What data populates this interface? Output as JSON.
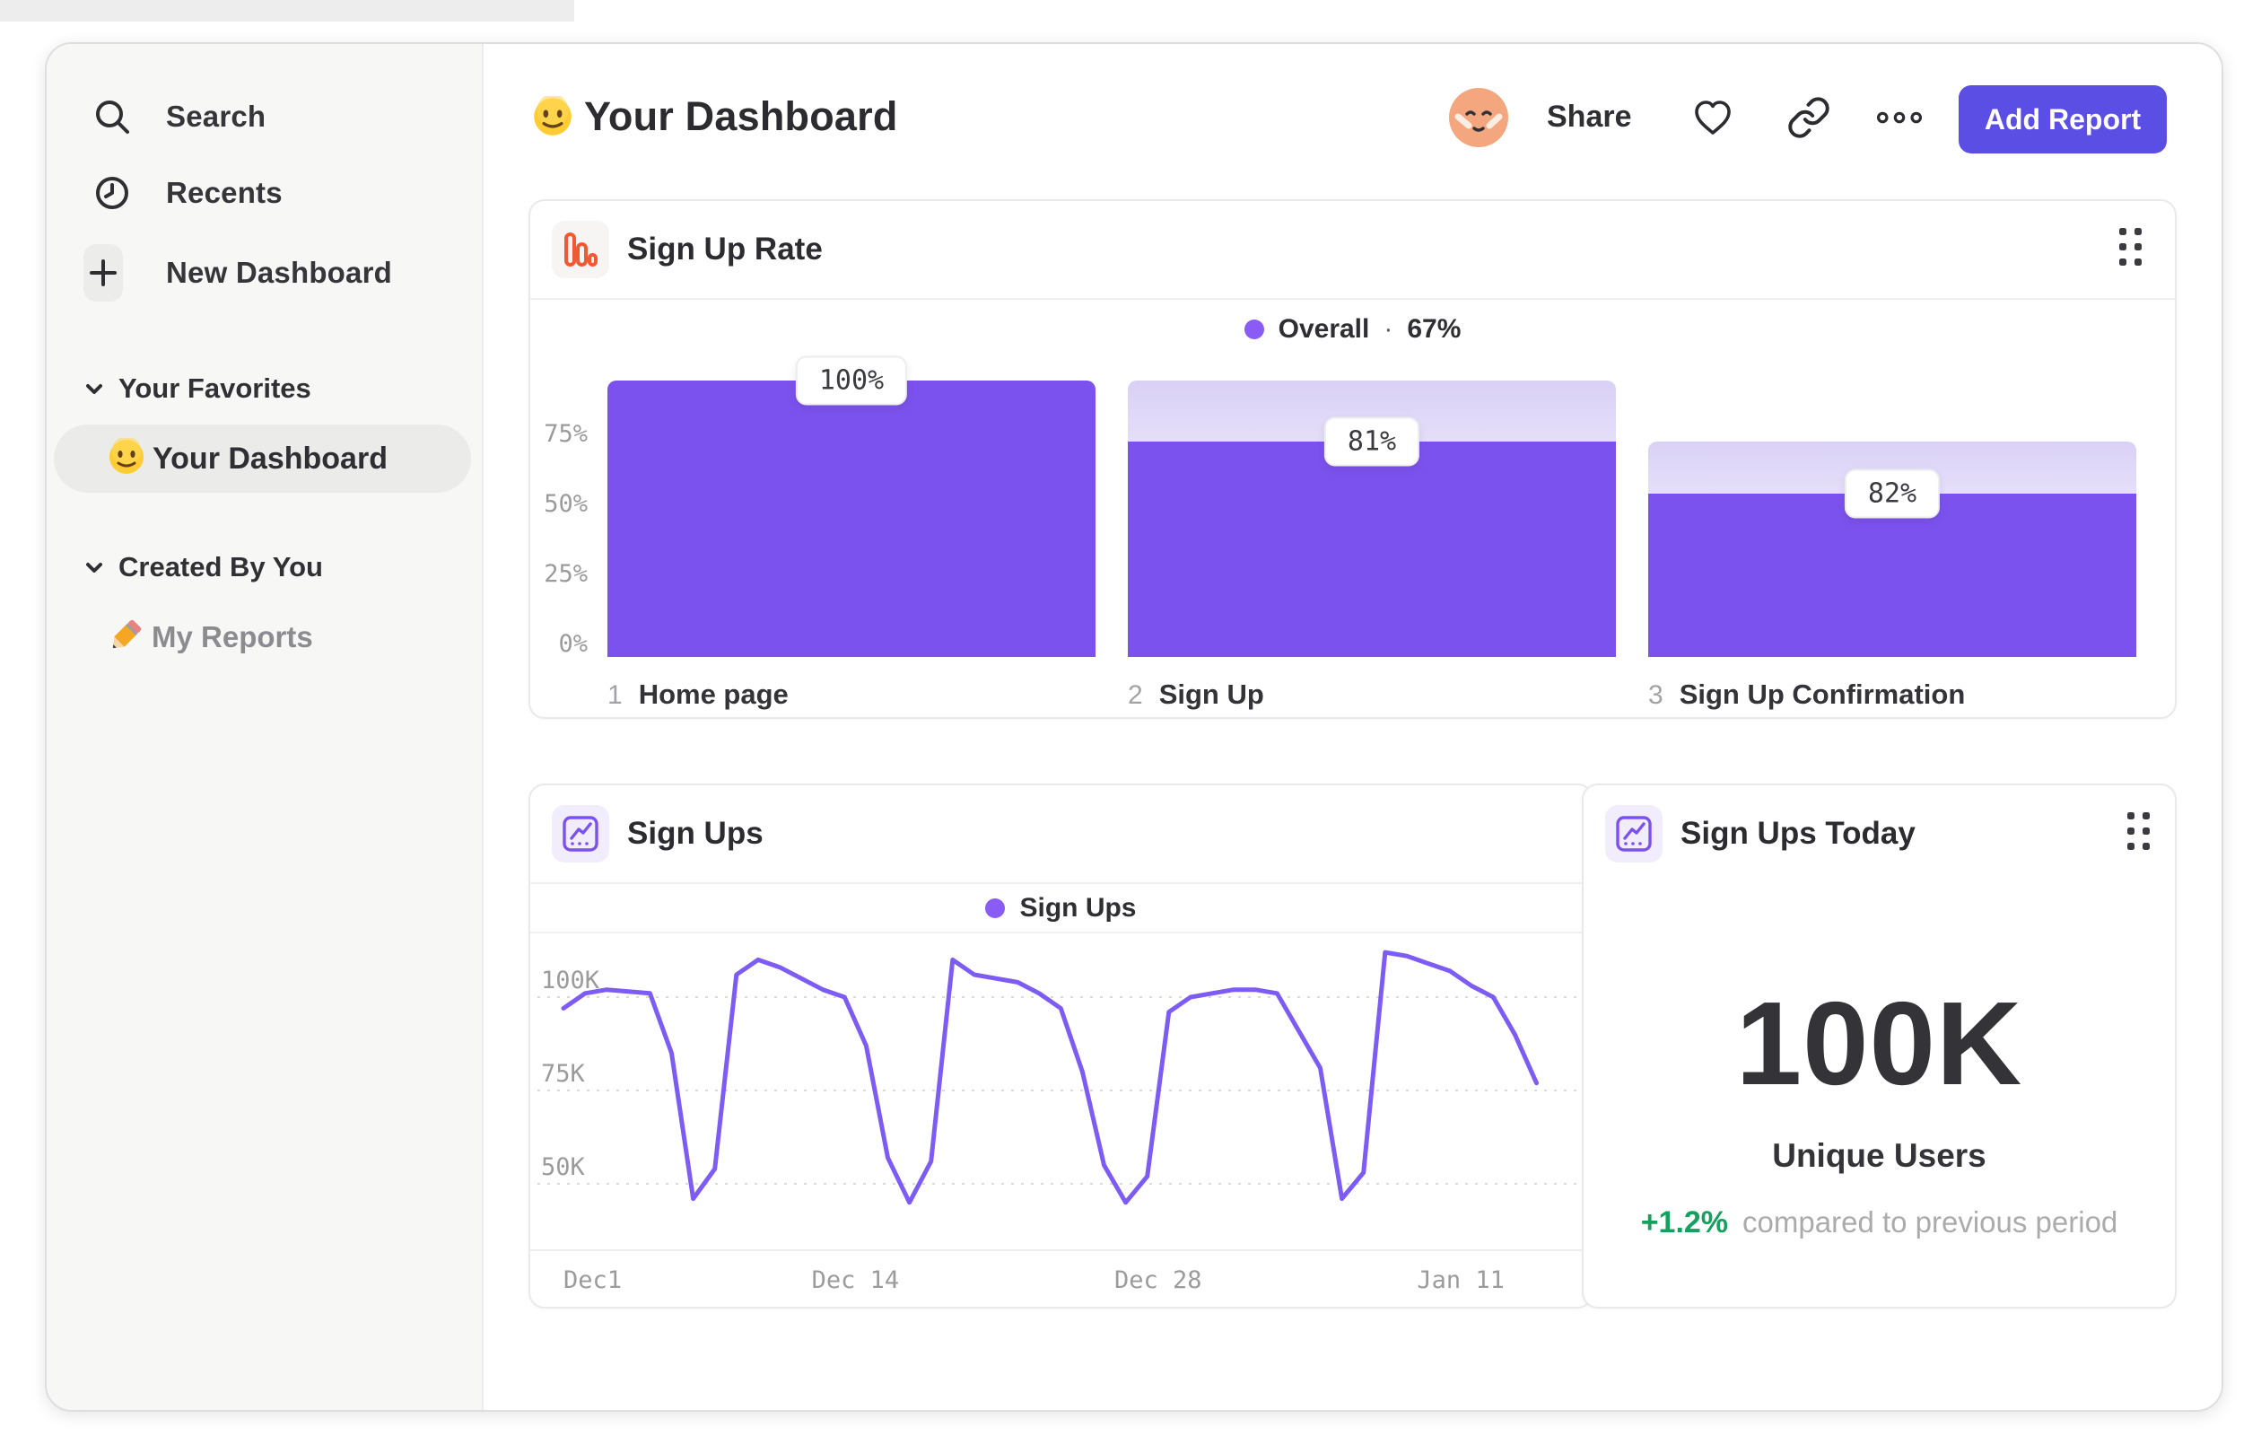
{
  "theme": {
    "accent_purple": "#5B4EE4",
    "bar_purple": "#7C52EE",
    "line_purple": "#7D5BF5",
    "legend_purple": "#8A5CF5",
    "icon_orange": "#EF5A33",
    "delta_green": "#14A05E"
  },
  "sidebar": {
    "nav": [
      {
        "label": "Search",
        "icon": "search-icon"
      },
      {
        "label": "Recents",
        "icon": "clock-icon"
      },
      {
        "label": "New Dashboard",
        "icon": "plus-icon"
      }
    ],
    "sections": [
      {
        "title": "Your Favorites",
        "items": [
          {
            "emoji": "slightly-smiling-face",
            "label": "Your Dashboard",
            "selected": true
          }
        ]
      },
      {
        "title": "Created By You",
        "items": [
          {
            "emoji": "pencil",
            "label": "My Reports",
            "selected": false
          }
        ]
      }
    ]
  },
  "header": {
    "emoji": "slightly-smiling-face",
    "title": "Your Dashboard",
    "share": "Share",
    "add_report": "Add Report"
  },
  "funnel_card": {
    "title": "Sign Up Rate",
    "legend": {
      "label": "Overall",
      "sep": "·",
      "value": "67%"
    }
  },
  "line_card": {
    "title": "Sign Ups",
    "legend": "Sign Ups"
  },
  "metric_card": {
    "title": "Sign Ups Today",
    "value": "100K",
    "label": "Unique Users",
    "delta": "+1.2%",
    "delta_desc": "compared to previous period"
  },
  "chart_data": [
    {
      "type": "bar",
      "subtype": "funnel",
      "title": "Sign Up Rate",
      "legend": "Overall · 67%",
      "legend_position": "top-center",
      "overall_conversion_pct": 67,
      "categories": [
        "Home page",
        "Sign Up",
        "Sign Up Confirmation"
      ],
      "steps": [
        {
          "num": "1",
          "label": "Home page",
          "conversion_label": "100%",
          "conversion_pct": 100,
          "entering_pct": 100,
          "cumulative_pct": 100
        },
        {
          "num": "2",
          "label": "Sign Up",
          "conversion_label": "81%",
          "conversion_pct": 81,
          "entering_pct": 100,
          "cumulative_pct": 81
        },
        {
          "num": "3",
          "label": "Sign Up Confirmation",
          "conversion_label": "82%",
          "conversion_pct": 82,
          "entering_pct": 81,
          "cumulative_pct": 67
        }
      ],
      "y_ticks": [
        {
          "label": "75%",
          "pct": 75
        },
        {
          "label": "50%",
          "pct": 50
        },
        {
          "label": "25%",
          "pct": 25
        },
        {
          "label": "0%",
          "pct": 0
        }
      ],
      "ylim": [
        0,
        100
      ],
      "grid": false,
      "bar_outer_pct": [
        100,
        100,
        78
      ],
      "bar_fill_pct": [
        100,
        78,
        59
      ]
    },
    {
      "type": "line",
      "title": "Sign Ups",
      "legend_position": "top-center",
      "series": [
        {
          "name": "Sign Ups",
          "unit": "K",
          "values": [
            97,
            101,
            102,
            101.5,
            101,
            85,
            46,
            54,
            106,
            110,
            108,
            105,
            102,
            100,
            87,
            57,
            45,
            56,
            110,
            106,
            105,
            104,
            101,
            97,
            80,
            55,
            45,
            52,
            96,
            100,
            101,
            102,
            102,
            101,
            91,
            81,
            46,
            53,
            112,
            111,
            109,
            107,
            103,
            100,
            90,
            77
          ]
        }
      ],
      "x_ticks": [
        {
          "label": "Dec1",
          "day": 0,
          "align": "left"
        },
        {
          "label": "Dec 14",
          "day": 13.5,
          "align": "center"
        },
        {
          "label": "Dec 28",
          "day": 27.5,
          "align": "center"
        },
        {
          "label": "Jan 11",
          "day": 41.5,
          "align": "center"
        }
      ],
      "days_span": 45,
      "y_ticks": [
        {
          "label": "100K",
          "value": 100
        },
        {
          "label": "75K",
          "value": 75
        },
        {
          "label": "50K",
          "value": 50
        }
      ],
      "ylim": [
        40,
        115
      ],
      "grid": "dashed-horizontal"
    },
    {
      "type": "metric",
      "title": "Sign Ups Today",
      "value": "100K",
      "label": "Unique Users",
      "delta_pct": "+1.2%",
      "delta_direction": "up",
      "comparison": "compared to previous period"
    }
  ]
}
